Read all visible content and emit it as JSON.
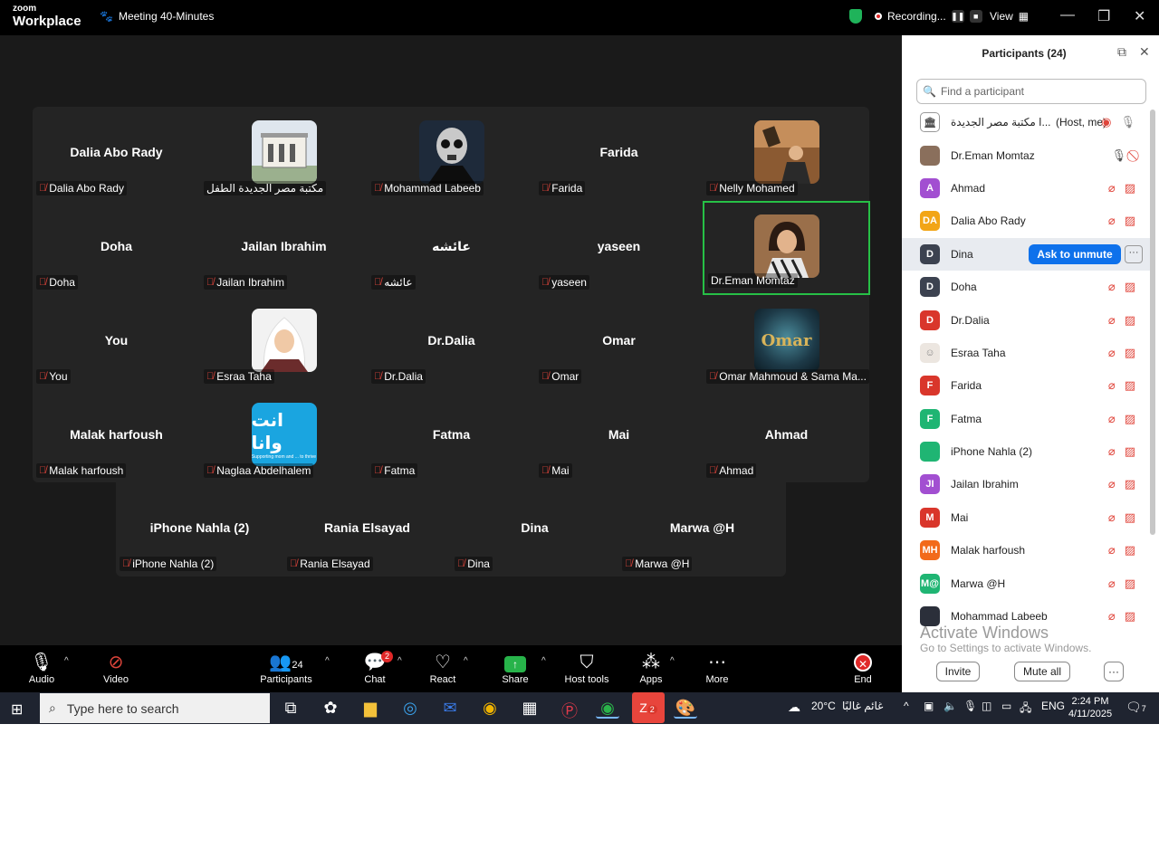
{
  "titlebar": {
    "logo_top": "zoom",
    "logo_bottom": "Workplace",
    "meeting_title": "Meeting 40-Minutes",
    "recording_label": "Recording...",
    "view_label": "View"
  },
  "grid": {
    "row1": [
      {
        "big": "Dalia Abo Rady",
        "name": "Dalia Abo Rady"
      },
      {
        "big": "",
        "name": "مكتبة مصر الجديدة الطفل"
      },
      {
        "big": "",
        "name": "Mohammad Labeeb"
      },
      {
        "big": "Farida",
        "name": "Farida"
      },
      {
        "big": "",
        "name": "Nelly Mohamed"
      }
    ],
    "row2": [
      {
        "big": "Doha",
        "name": "Doha"
      },
      {
        "big": "Jailan Ibrahim",
        "name": "Jailan Ibrahim"
      },
      {
        "big": "عائشه",
        "name": "عائشه"
      },
      {
        "big": "yaseen",
        "name": "yaseen"
      },
      {
        "big": "",
        "name": "Dr.Eman Momtaz"
      }
    ],
    "row3": [
      {
        "big": "You",
        "name": "You"
      },
      {
        "big": "",
        "name": "Esraa Taha"
      },
      {
        "big": "Dr.Dalia",
        "name": "Dr.Dalia"
      },
      {
        "big": "Omar",
        "name": "Omar"
      },
      {
        "big": "",
        "name": "Omar Mahmoud & Sama Ma..."
      }
    ],
    "row4": [
      {
        "big": "Malak harfoush",
        "name": "Malak harfoush"
      },
      {
        "big": "",
        "name": "Naglaa Abdelhalem"
      },
      {
        "big": "Fatma",
        "name": "Fatma"
      },
      {
        "big": "Mai",
        "name": "Mai"
      },
      {
        "big": "Ahmad",
        "name": "Ahmad"
      }
    ],
    "row5": [
      {
        "big": "iPhone Nahla (2)",
        "name": "iPhone Nahla (2)"
      },
      {
        "big": "Rania Elsayad",
        "name": "Rania Elsayad"
      },
      {
        "big": "Dina",
        "name": "Dina"
      },
      {
        "big": "Marwa @H",
        "name": "Marwa @H"
      }
    ],
    "logo_text": "انت وانا",
    "logo_sub": "Supporting mom and ... to thrive",
    "omar_text": "Omar"
  },
  "panel": {
    "title": "Participants (24)",
    "search_placeholder": "Find a participant",
    "host_suffix": "(Host, me)",
    "ask_unmute": "Ask to unmute",
    "participants": [
      {
        "name": "ا مكتبة مصر الجديدة...",
        "initials": "",
        "color": "#6b6b6b"
      },
      {
        "name": "Dr.Eman Momtaz",
        "initials": "",
        "color": "#8a6f5c"
      },
      {
        "name": "Ahmad",
        "initials": "A",
        "color": "#a24fd1"
      },
      {
        "name": "Dalia Abo Rady",
        "initials": "DA",
        "color": "#f2a516"
      },
      {
        "name": "Dina",
        "initials": "D",
        "color": "#3c4250"
      },
      {
        "name": "Doha",
        "initials": "D",
        "color": "#3c4250"
      },
      {
        "name": "Dr.Dalia",
        "initials": "D",
        "color": "#d9362b"
      },
      {
        "name": "Esraa Taha",
        "initials": "",
        "color": "#cfcfcf"
      },
      {
        "name": "Farida",
        "initials": "F",
        "color": "#d9362b"
      },
      {
        "name": "Fatma",
        "initials": "F",
        "color": "#1fb573"
      },
      {
        "name": "iPhone Nahla (2)",
        "initials": "",
        "color": "#1fb573"
      },
      {
        "name": "Jailan Ibrahim",
        "initials": "JI",
        "color": "#a24fd1"
      },
      {
        "name": "Mai",
        "initials": "M",
        "color": "#d9362b"
      },
      {
        "name": "Malak harfoush",
        "initials": "MH",
        "color": "#f26a1b"
      },
      {
        "name": "Marwa @H",
        "initials": "M@",
        "color": "#1fb573"
      },
      {
        "name": "Mohammad Labeeb",
        "initials": "",
        "color": "#2b2f3a"
      }
    ],
    "watermark_1": "Activate Windows",
    "watermark_2": "Go to Settings to activate Windows.",
    "invite": "Invite",
    "mute_all": "Mute all"
  },
  "toolbar": {
    "audio": "Audio",
    "video": "Video",
    "participants": "Participants",
    "participants_count": "24",
    "chat": "Chat",
    "chat_badge": "2",
    "react": "React",
    "share": "Share",
    "host_tools": "Host tools",
    "apps": "Apps",
    "more": "More",
    "end": "End"
  },
  "taskbar": {
    "search_placeholder": "Type here to search",
    "zoom_badge": "2",
    "weather": "20°C",
    "weather_desc": "غائم غالبًا",
    "lang": "ENG",
    "time": "2:24 PM",
    "date": "4/11/2025",
    "notif_count": "7"
  }
}
